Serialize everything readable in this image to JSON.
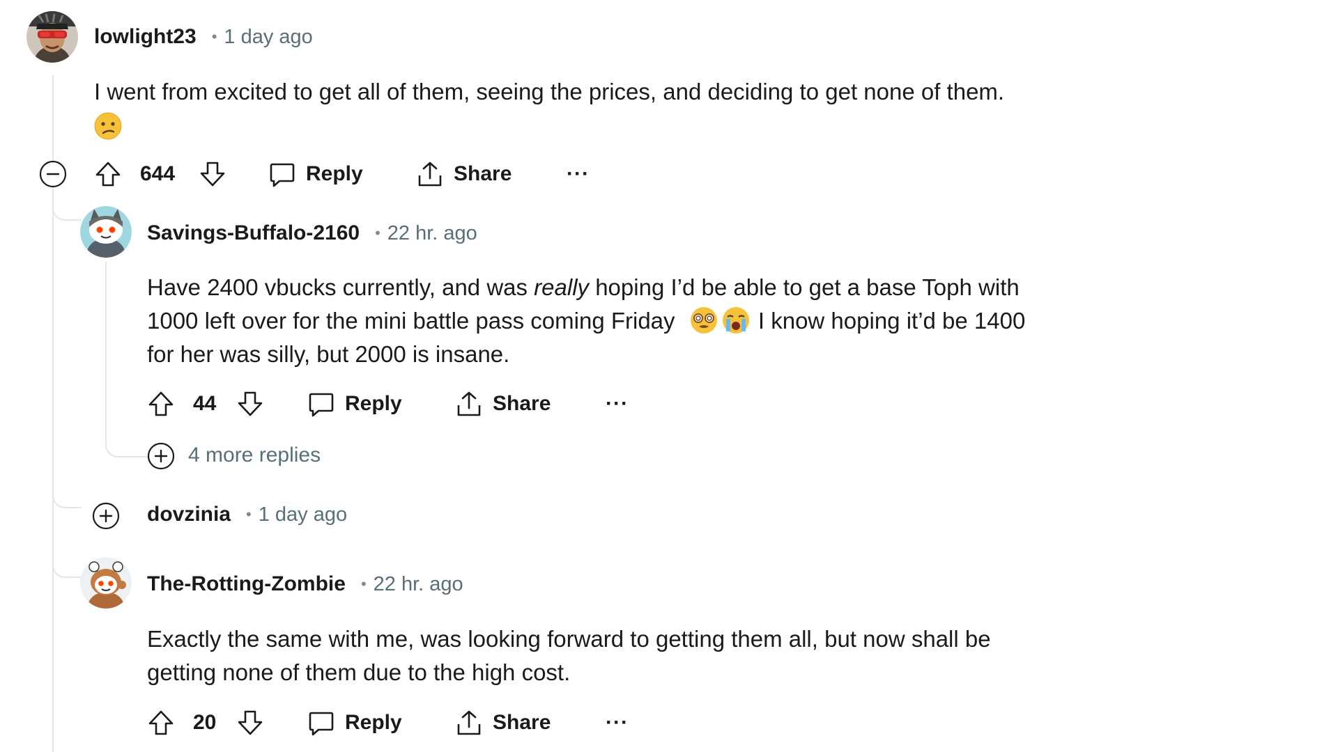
{
  "comments": [
    {
      "username": "lowlight23",
      "separator": "•",
      "time": "1 day ago",
      "body": [
        "I went from excited to get all of them, seeing the prices, and deciding to get none of them."
      ],
      "emoji": "confused-face-emoji",
      "score": "644",
      "reply_label": "Reply",
      "share_label": "Share",
      "more_label": "···"
    },
    {
      "username": "Savings-Buffalo-2160",
      "separator": "•",
      "time": "22 hr. ago",
      "body_l1_pre": "Have 2400 vbucks currently, and was ",
      "body_l1_em": "really",
      "body_l1_post": " hoping I’d be able to get a base Toph with",
      "body_l2_pre": "1000 left over for the mini battle pass coming Friday",
      "body_l2_post": " I know hoping it’d be 1400",
      "body_l3": "for her was silly, but 2000 is insane.",
      "emojis": [
        "dizzy-face-emoji",
        "crying-face-emoji"
      ],
      "score": "44",
      "reply_label": "Reply",
      "share_label": "Share",
      "more_label": "···",
      "more_replies": "4 more replies"
    },
    {
      "username": "dovzinia",
      "separator": "•",
      "time": "1 day ago",
      "collapsed": true
    },
    {
      "username": "The-Rotting-Zombie",
      "separator": "•",
      "time": "22 hr. ago",
      "body": [
        "Exactly the same with me, was looking forward to getting them all, but now shall be",
        "getting none of them due to the high cost."
      ],
      "score": "20",
      "reply_label": "Reply",
      "share_label": "Share",
      "more_label": "···"
    }
  ],
  "colors": {
    "text": "#1a1a1b",
    "meta": "#576f76",
    "thread_line": "#e3e6e8",
    "emoji_yellow": "#f7c23a"
  }
}
